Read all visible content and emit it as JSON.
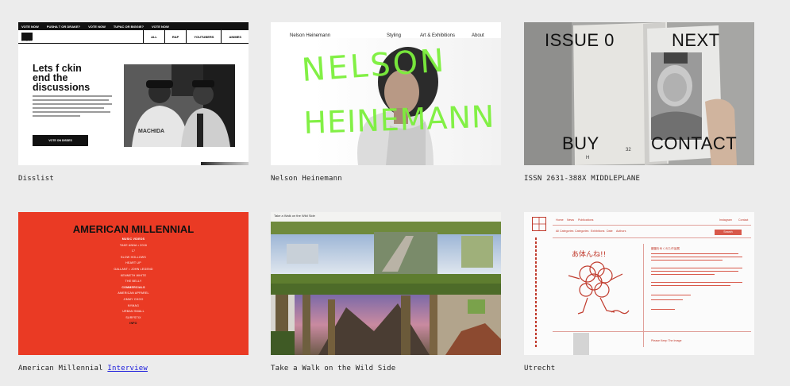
{
  "projects": [
    {
      "caption": "Disslist",
      "ticker": [
        "VOTE NOW",
        "PUSHA T OR DRAKE?",
        "VOTE NOW",
        "TUPAC OR BIGGIE?",
        "VOTE NOW"
      ],
      "logo_label": "DISSLIST",
      "tabs": [
        "ALL",
        "RAP",
        "YOUTUBERS",
        "ANIMES"
      ],
      "hero": [
        "Lets f ckin",
        "end the",
        "discussions"
      ],
      "button": "VOTE ON DISSES"
    },
    {
      "caption": "Nelson Heinemann",
      "nav": [
        "Nelson Heinemann",
        "Styling",
        "Art & Exhibitions",
        "About"
      ],
      "scrawl_line1": "NELSON",
      "scrawl_line2": "HEINEMANN"
    },
    {
      "caption": "ISSN 2631-388X MIDDLEPLANE",
      "labels": {
        "issue": "ISSUE 0",
        "next": "NEXT",
        "buy": "BUY",
        "contact": "CONTACT"
      },
      "page_marks": {
        "left": "H",
        "right": "32"
      }
    },
    {
      "caption": "American Millennial",
      "caption_link": "Interview",
      "title": "AMERICAN MILLENNIAL",
      "list": [
        {
          "t": "MUSIC VIDEOS",
          "s": "b"
        },
        {
          "t": "TAKE ANNA • 2016",
          "s": ""
        },
        {
          "t": "17",
          "s": ""
        },
        {
          "t": "SLOW HOLLOWS",
          "s": ""
        },
        {
          "t": "HEART UP",
          "s": ""
        },
        {
          "t": "GALLANT • JOHN LEGEND",
          "s": ""
        },
        {
          "t": "KENNETH WHITE",
          "s": ""
        },
        {
          "t": "THE BELLY",
          "s": ""
        },
        {
          "t": "COMMERCIALS",
          "s": "b"
        },
        {
          "t": "AMERICAN APPAREL",
          "s": ""
        },
        {
          "t": "JIMMY CHOO",
          "s": ""
        },
        {
          "t": "NYMAG",
          "s": ""
        },
        {
          "t": "URBAN SMALL",
          "s": ""
        },
        {
          "t": "SURFSTIX",
          "s": ""
        },
        {
          "t": "INFO",
          "s": "k"
        }
      ]
    },
    {
      "caption": "Take a Walk on the Wild Side",
      "header": "Take a Walk on the Wild Side"
    },
    {
      "caption": "Utrecht",
      "nav": [
        "Home",
        "News",
        "Publications",
        "Instagram",
        "Contact"
      ],
      "filters": [
        "All Categories",
        "Categories",
        "Exhibitions",
        "Date",
        "Authors"
      ],
      "search_button": "Search",
      "sketch_text": "あ体んね!!",
      "body_title": "鍵盤をめくれた作品展",
      "footer_title": "Please Keep The Image"
    }
  ]
}
